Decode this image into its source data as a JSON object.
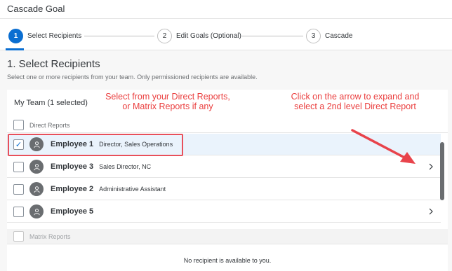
{
  "window": {
    "title": "Cascade Goal"
  },
  "wizard": {
    "steps": [
      {
        "number": "1",
        "label": "Select Recipients",
        "active": true
      },
      {
        "number": "2",
        "label": "Edit Goals (Optional)",
        "active": false
      },
      {
        "number": "3",
        "label": "Cascade",
        "active": false
      }
    ]
  },
  "page": {
    "heading": "1. Select Recipients",
    "subtitle": "Select one or more recipients from your team. Only permissioned recipients are available."
  },
  "team": {
    "title": "My Team (1 selected)",
    "direct_reports_header": "Direct Reports",
    "matrix_reports_header": "Matrix Reports",
    "empty_message": "No recipient is available to you.",
    "employees": [
      {
        "name": "Employee 1",
        "role": "Director, Sales Operations",
        "selected": true,
        "expandable": false
      },
      {
        "name": "Employee 3",
        "role": "Sales Director, NC",
        "selected": false,
        "expandable": true
      },
      {
        "name": "Employee 2",
        "role": "Administrative Assistant",
        "selected": false,
        "expandable": false
      },
      {
        "name": "Employee 5",
        "role": "",
        "selected": false,
        "expandable": true
      }
    ]
  },
  "annotations": {
    "left_note": "Select from your Direct Reports, or Matrix Reports if any",
    "right_note": "Click on the arrow to expand and select a 2nd level Direct Report"
  },
  "colors": {
    "accent": "#0a6ed1",
    "annotation": "#ea3e3e",
    "selected_row": "#eaf3fc"
  }
}
